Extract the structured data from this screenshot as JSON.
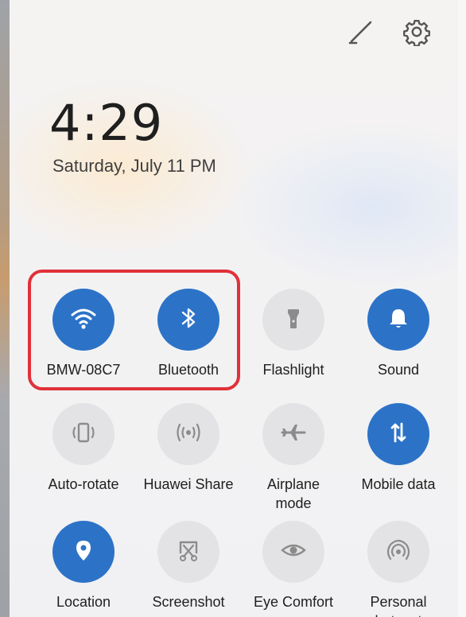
{
  "clock": {
    "time": "4:29",
    "date": "Saturday, July 11  PM"
  },
  "toolbar": {
    "edit_icon": "pencil-icon",
    "settings_icon": "gear-icon"
  },
  "highlight_color": "#e0313a",
  "accent_color": "#2c73c8",
  "tiles": [
    {
      "label": "BMW-08C7",
      "icon": "wifi-icon",
      "active": true
    },
    {
      "label": "Bluetooth",
      "icon": "bluetooth-icon",
      "active": true
    },
    {
      "label": "Flashlight",
      "icon": "flashlight-icon",
      "active": false
    },
    {
      "label": "Sound",
      "icon": "bell-icon",
      "active": true
    },
    {
      "label": "Auto-rotate",
      "icon": "auto-rotate-icon",
      "active": false
    },
    {
      "label": "Huawei Share",
      "icon": "huawei-share-icon",
      "active": false
    },
    {
      "label": "Airplane\nmode",
      "icon": "airplane-icon",
      "active": false
    },
    {
      "label": "Mobile data",
      "icon": "mobile-data-icon",
      "active": true
    },
    {
      "label": "Location",
      "icon": "location-icon",
      "active": true
    },
    {
      "label": "Screenshot",
      "icon": "screenshot-icon",
      "active": false
    },
    {
      "label": "Eye Comfort",
      "icon": "eye-icon",
      "active": false
    },
    {
      "label": "Personal\nhotspot",
      "icon": "hotspot-icon",
      "active": false
    }
  ]
}
